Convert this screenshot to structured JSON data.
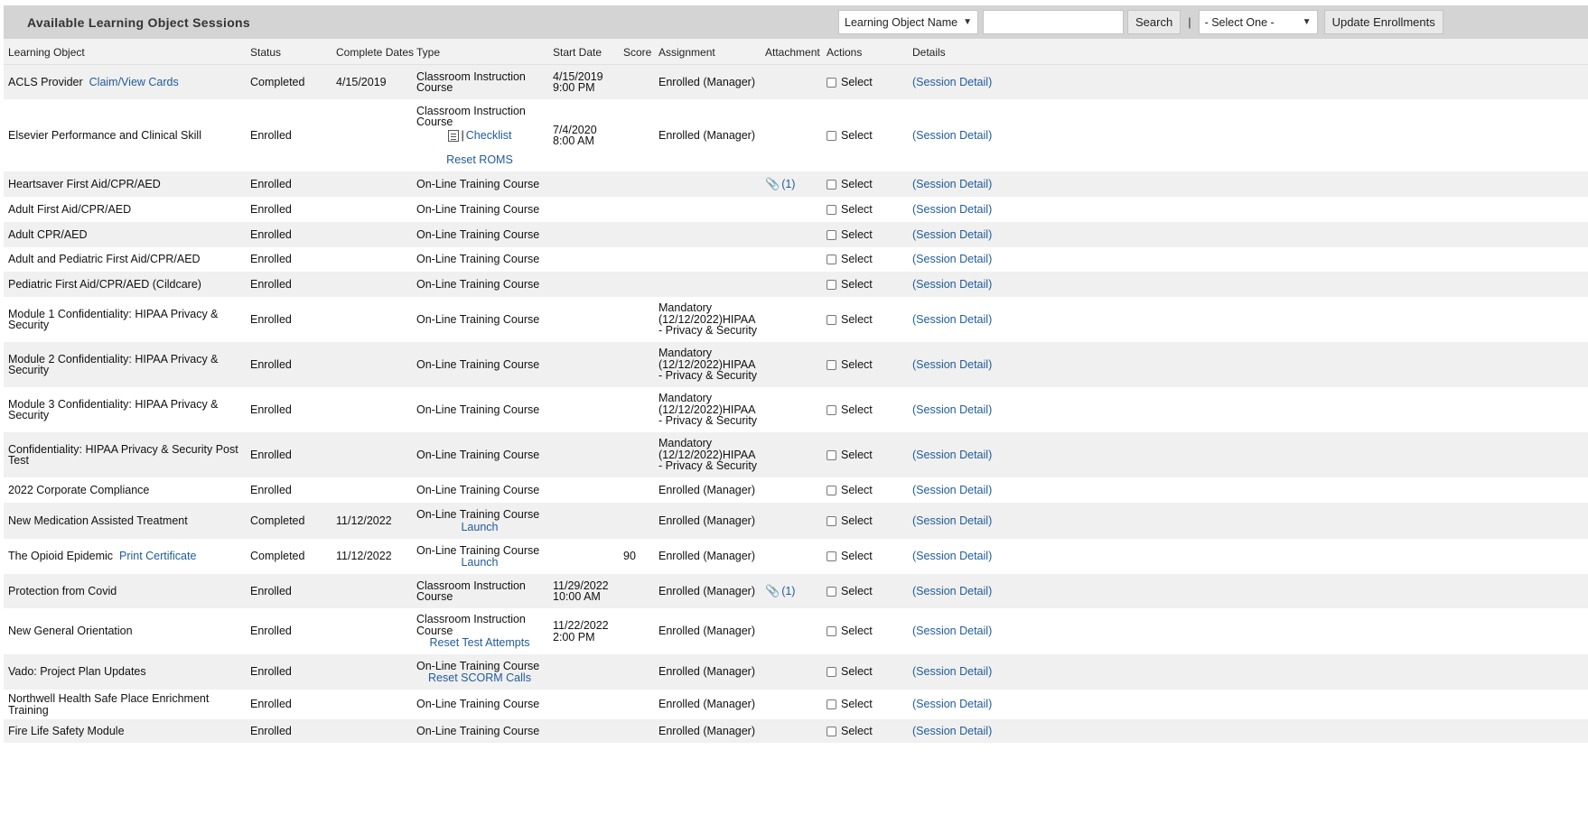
{
  "header": {
    "title": "Available Learning Object Sessions",
    "search_field_select": "Learning Object Name",
    "search_input_value": "",
    "search_button": "Search",
    "separator": "|",
    "bulk_select": "- Select One -",
    "update_button": "Update Enrollments"
  },
  "columns": {
    "learning_object": "Learning Object",
    "status": "Status",
    "complete_dates": "Complete Dates",
    "type": "Type",
    "start_date": "Start Date",
    "score": "Score",
    "assignment": "Assignment",
    "attachment": "Attachment",
    "actions": "Actions",
    "details": "Details"
  },
  "rows": [
    {
      "name": "ACLS Provider",
      "name_link": "Claim/View Cards",
      "status": "Completed",
      "complete": "4/15/2019",
      "type": "Classroom Instruction Course",
      "type_links": [],
      "start1": "4/15/2019",
      "start2": "9:00 PM",
      "score": "",
      "assign": "Enrolled (Manager)",
      "attach": "",
      "action": "Select",
      "detail": "(Session Detail)"
    },
    {
      "name": "Elsevier Performance and Clinical Skill",
      "name_link": "",
      "status": "Enrolled",
      "complete": "",
      "type": "Classroom Instruction Course",
      "type_links": [
        "Checklist",
        "Reset ROMS"
      ],
      "start1": "7/4/2020",
      "start2": "8:00 AM",
      "score": "",
      "assign": "Enrolled (Manager)",
      "attach": "",
      "action": "Select",
      "detail": "(Session Detail)"
    },
    {
      "name": "Heartsaver First Aid/CPR/AED",
      "name_link": "",
      "status": "Enrolled",
      "complete": "",
      "type": "On-Line Training Course",
      "type_links": [],
      "start1": "",
      "start2": "",
      "score": "",
      "assign": "",
      "attach": "(1)",
      "action": "Select",
      "detail": "(Session Detail)"
    },
    {
      "name": "Adult First Aid/CPR/AED",
      "name_link": "",
      "status": "Enrolled",
      "complete": "",
      "type": "On-Line Training Course",
      "type_links": [],
      "start1": "",
      "start2": "",
      "score": "",
      "assign": "",
      "attach": "",
      "action": "Select",
      "detail": "(Session Detail)"
    },
    {
      "name": "Adult CPR/AED",
      "name_link": "",
      "status": "Enrolled",
      "complete": "",
      "type": "On-Line Training Course",
      "type_links": [],
      "start1": "",
      "start2": "",
      "score": "",
      "assign": "",
      "attach": "",
      "action": "Select",
      "detail": "(Session Detail)"
    },
    {
      "name": "Adult and Pediatric First Aid/CPR/AED",
      "name_link": "",
      "status": "Enrolled",
      "complete": "",
      "type": "On-Line Training Course",
      "type_links": [],
      "start1": "",
      "start2": "",
      "score": "",
      "assign": "",
      "attach": "",
      "action": "Select",
      "detail": "(Session Detail)"
    },
    {
      "name": "Pediatric First Aid/CPR/AED (Cildcare)",
      "name_link": "",
      "status": "Enrolled",
      "complete": "",
      "type": "On-Line Training Course",
      "type_links": [],
      "start1": "",
      "start2": "",
      "score": "",
      "assign": "",
      "attach": "",
      "action": "Select",
      "detail": "(Session Detail)"
    },
    {
      "name": "Module 1 Confidentiality: HIPAA Privacy & Security",
      "name_link": "",
      "status": "Enrolled",
      "complete": "",
      "type": "On-Line Training Course",
      "type_links": [],
      "start1": "",
      "start2": "",
      "score": "",
      "assign": "Mandatory (12/12/2022)HIPAA - Privacy & Security",
      "attach": "",
      "action": "Select",
      "detail": "(Session Detail)"
    },
    {
      "name": "Module 2 Confidentiality: HIPAA Privacy & Security",
      "name_link": "",
      "status": "Enrolled",
      "complete": "",
      "type": "On-Line Training Course",
      "type_links": [],
      "start1": "",
      "start2": "",
      "score": "",
      "assign": "Mandatory (12/12/2022)HIPAA - Privacy & Security",
      "attach": "",
      "action": "Select",
      "detail": "(Session Detail)"
    },
    {
      "name": "Module 3 Confidentiality: HIPAA Privacy & Security",
      "name_link": "",
      "status": "Enrolled",
      "complete": "",
      "type": "On-Line Training Course",
      "type_links": [],
      "start1": "",
      "start2": "",
      "score": "",
      "assign": "Mandatory (12/12/2022)HIPAA - Privacy & Security",
      "attach": "",
      "action": "Select",
      "detail": "(Session Detail)"
    },
    {
      "name": "Confidentiality: HIPAA Privacy & Security Post Test",
      "name_link": "",
      "status": "Enrolled",
      "complete": "",
      "type": "On-Line Training Course",
      "type_links": [],
      "start1": "",
      "start2": "",
      "score": "",
      "assign": "Mandatory (12/12/2022)HIPAA - Privacy & Security",
      "attach": "",
      "action": "Select",
      "detail": "(Session Detail)"
    },
    {
      "name": "2022 Corporate Compliance",
      "name_link": "",
      "status": "Enrolled",
      "complete": "",
      "type": "On-Line Training Course",
      "type_links": [],
      "start1": "",
      "start2": "",
      "score": "",
      "assign": "Enrolled (Manager)",
      "attach": "",
      "action": "Select",
      "detail": "(Session Detail)"
    },
    {
      "name": "New Medication Assisted Treatment",
      "name_link": "",
      "status": "Completed",
      "complete": "11/12/2022",
      "type": "On-Line Training Course",
      "type_links": [
        "Launch"
      ],
      "start1": "",
      "start2": "",
      "score": "",
      "assign": "Enrolled (Manager)",
      "attach": "",
      "action": "Select",
      "detail": "(Session Detail)"
    },
    {
      "name": "The Opioid Epidemic",
      "name_link": "Print Certificate",
      "status": "Completed",
      "complete": "11/12/2022",
      "type": "On-Line Training Course",
      "type_links": [
        "Launch"
      ],
      "start1": "",
      "start2": "",
      "score": "90",
      "assign": "Enrolled (Manager)",
      "attach": "",
      "action": "Select",
      "detail": "(Session Detail)"
    },
    {
      "name": "Protection from Covid",
      "name_link": "",
      "status": "Enrolled",
      "complete": "",
      "type": "Classroom Instruction Course",
      "type_links": [],
      "start1": "11/29/2022",
      "start2": "10:00 AM",
      "score": "",
      "assign": "Enrolled (Manager)",
      "attach": "(1)",
      "action": "Select",
      "detail": "(Session Detail)"
    },
    {
      "name": "New General Orientation",
      "name_link": "",
      "status": "Enrolled",
      "complete": "",
      "type": "Classroom Instruction Course",
      "type_links": [
        "Reset Test Attempts"
      ],
      "start1": "11/22/2022",
      "start2": "2:00 PM",
      "score": "",
      "assign": "Enrolled (Manager)",
      "attach": "",
      "action": "Select",
      "detail": "(Session Detail)"
    },
    {
      "name": "Vado: Project Plan Updates",
      "name_link": "",
      "status": "Enrolled",
      "complete": "",
      "type": "On-Line Training Course",
      "type_links": [
        "Reset SCORM Calls"
      ],
      "start1": "",
      "start2": "",
      "score": "",
      "assign": "Enrolled (Manager)",
      "attach": "",
      "action": "Select",
      "detail": "(Session Detail)"
    },
    {
      "name": "Northwell Health Safe Place Enrichment Training",
      "name_link": "",
      "status": "Enrolled",
      "complete": "",
      "type": "On-Line Training Course",
      "type_links": [],
      "start1": "",
      "start2": "",
      "score": "",
      "assign": "Enrolled (Manager)",
      "attach": "",
      "action": "Select",
      "detail": "(Session Detail)"
    },
    {
      "name": "Fire Life Safety Module",
      "name_link": "",
      "status": "Enrolled",
      "complete": "",
      "type": "On-Line Training Course",
      "type_links": [],
      "start1": "",
      "start2": "",
      "score": "",
      "assign": "Enrolled (Manager)",
      "attach": "",
      "action": "Select",
      "detail": "(Session Detail)"
    }
  ]
}
